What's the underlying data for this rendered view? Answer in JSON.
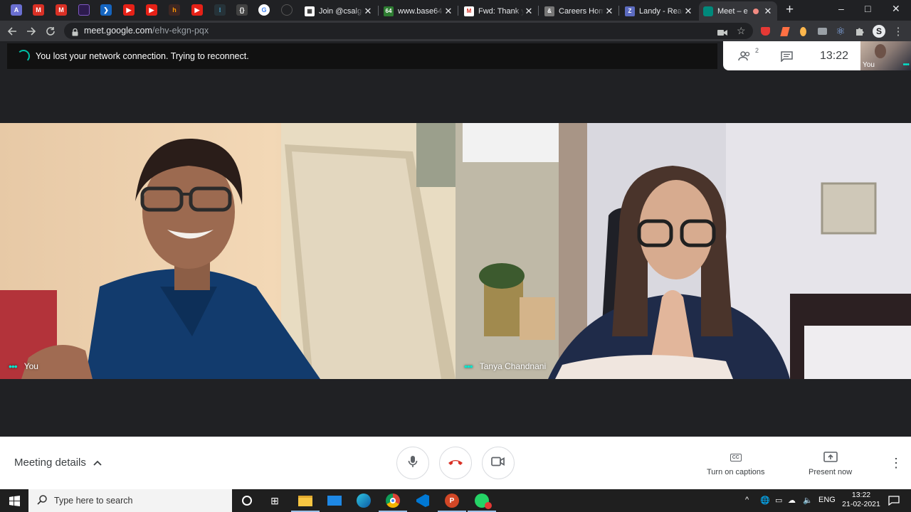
{
  "tabs": [
    {
      "title": "Join @csalgo",
      "close": "✕"
    },
    {
      "title": "www.base64",
      "close": "✕"
    },
    {
      "title": "Fwd: Thank y",
      "close": "✕"
    },
    {
      "title": "Careers Hom",
      "close": "✕"
    },
    {
      "title": "Landy - Reac",
      "close": "✕"
    },
    {
      "title": "Meet – e",
      "close": "✕"
    }
  ],
  "new_tab": "+",
  "window_controls": {
    "minimize": "–",
    "maximize": "□",
    "close": "✕"
  },
  "omnibox": {
    "host": "meet.google.com",
    "path": "/ehv-ekgn-pqx"
  },
  "reconnect_banner": "You lost your network connection. Trying to reconnect.",
  "meet_header": {
    "participant_count": "2",
    "time": "13:22",
    "self_label": "You"
  },
  "tiles": [
    {
      "name": "You",
      "indicator": "•••"
    },
    {
      "name": "Tanya Chandnani",
      "indicator": "•••"
    }
  ],
  "bottom_bar": {
    "meeting_details": "Meeting details",
    "captions_label": "Turn on captions",
    "captions_icon_text": "CC",
    "present_label": "Present now",
    "more": "⋮"
  },
  "taskbar": {
    "search_placeholder": "Type here to search",
    "language": "ENG",
    "time": "13:22",
    "date": "21-02-2021"
  },
  "colors": {
    "accent": "#00bfa5",
    "end_call": "#d93025",
    "chrome_dark": "#202124",
    "chrome_toolbar": "#35363a"
  }
}
